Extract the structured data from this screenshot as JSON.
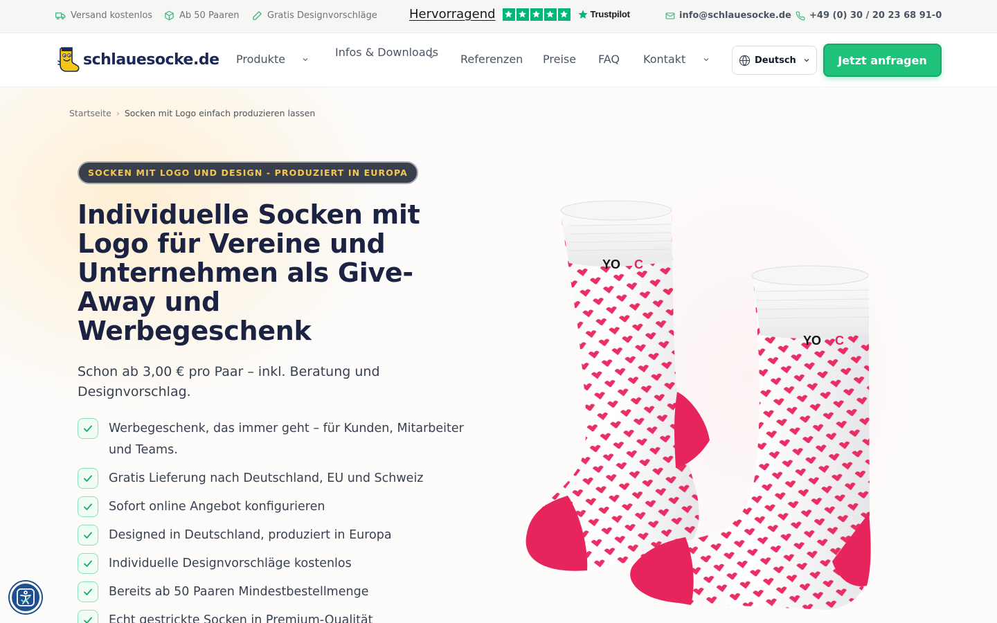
{
  "topbar": {
    "usps": [
      {
        "icon": "truck-icon",
        "label": "Versand kostenlos"
      },
      {
        "icon": "box-icon",
        "label": "Ab 50 Paaren"
      },
      {
        "icon": "pencil-icon",
        "label": "Gratis Designvorschläge"
      }
    ],
    "trustpilot": {
      "rating_label": "Hervorragend",
      "stars": 5,
      "brand": "Trustpilot"
    },
    "email": "info@schlauesocke.de",
    "phone": "+49 (0) 30 / 20 23 68 91-0"
  },
  "header": {
    "logo_text": "schlauesocke.de",
    "nav": [
      {
        "label": "Produkte",
        "has_dropdown": true
      },
      {
        "label": "Infos & Downloads",
        "has_dropdown": true
      },
      {
        "label": "Referenzen",
        "has_dropdown": false
      },
      {
        "label": "Preise",
        "has_dropdown": false
      },
      {
        "label": "FAQ",
        "has_dropdown": false
      },
      {
        "label": "Kontakt",
        "has_dropdown": true
      }
    ],
    "language": "Deutsch",
    "cta_label": "Jetzt anfragen"
  },
  "hero": {
    "breadcrumb": [
      "Startseite",
      "Socken mit Logo einfach produzieren lassen"
    ],
    "badge": "SOCKEN MIT LOGO UND DESIGN - PRODUZIERT IN EUROPA",
    "title": "Individuelle Socken mit Logo für Vereine und Unternehmen als Give-Away und Werbegeschenk",
    "subtitle": "Schon ab 3,00 € pro Paar – inkl. Beratung und Designvorschlag.",
    "features": [
      "Werbegeschenk, das immer geht – für Kunden, Mitarbeiter und Teams.",
      "Gratis Lieferung nach Deutschland, EU und Schweiz",
      "Sofort online Angebot konfigurieren",
      "Designed in Deutschland, produziert in Europa",
      "Individuelle Designvorschläge kostenlos",
      "Bereits ab 50 Paaren Mindestbestellmenge",
      "Echt gestrickte Socken in Premium-Qualität"
    ]
  },
  "colors": {
    "accent_green": "#1ec27a",
    "navy": "#1c2242",
    "badge_yellow": "#f5c84c",
    "sock_pink": "#e8245c",
    "trustpilot_green": "#00b67a"
  }
}
